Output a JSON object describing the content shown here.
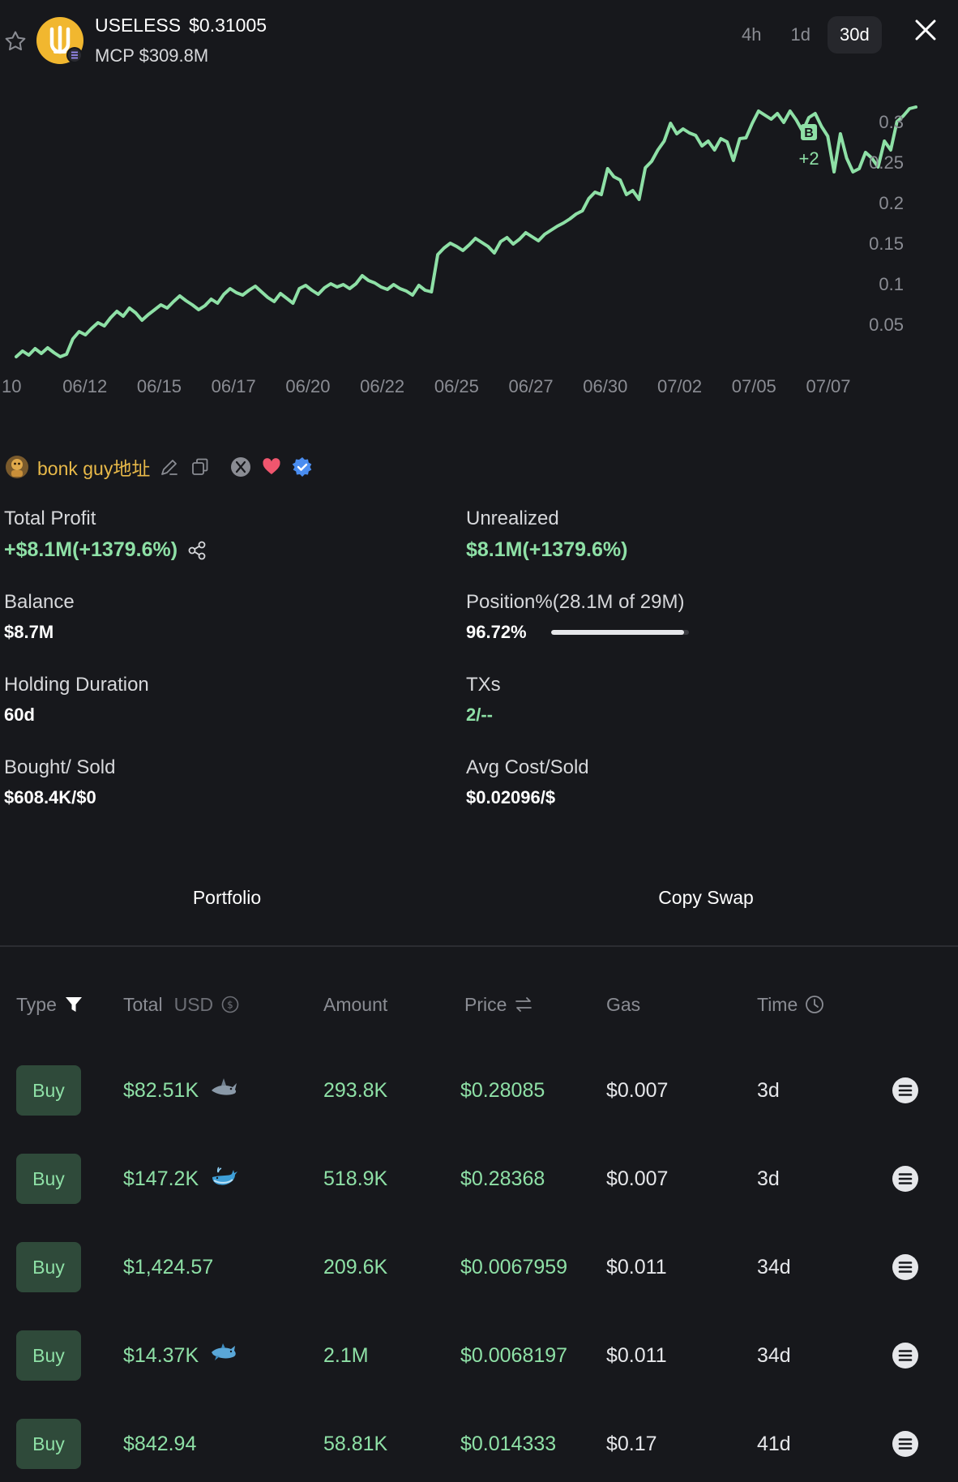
{
  "header": {
    "token_symbol": "USELESS",
    "price": "$0.31005",
    "mcp": "MCP $309.8M",
    "ranges": [
      "4h",
      "1d",
      "30d"
    ],
    "active_range": "30d"
  },
  "colors": {
    "background": "#17181c",
    "accent_green": "#8ee0a6",
    "wallet_name": "#e8b949",
    "logo": "#f1b72f"
  },
  "chart_data": {
    "type": "line",
    "series": [
      {
        "values": [
          0.01,
          0.017,
          0.012,
          0.02,
          0.014,
          0.021,
          0.015,
          0.01,
          0.013,
          0.032,
          0.041,
          0.037,
          0.045,
          0.052,
          0.048,
          0.058,
          0.066,
          0.06,
          0.07,
          0.064,
          0.055,
          0.062,
          0.068,
          0.074,
          0.07,
          0.078,
          0.085,
          0.079,
          0.074,
          0.068,
          0.073,
          0.081,
          0.076,
          0.087,
          0.094,
          0.089,
          0.086,
          0.092,
          0.097,
          0.09,
          0.083,
          0.078,
          0.088,
          0.082,
          0.076,
          0.094,
          0.098,
          0.092,
          0.087,
          0.095,
          0.1,
          0.096,
          0.099,
          0.094,
          0.1,
          0.11,
          0.104,
          0.101,
          0.096,
          0.093,
          0.099,
          0.094,
          0.091,
          0.086,
          0.098,
          0.092,
          0.09,
          0.136,
          0.144,
          0.15,
          0.146,
          0.141,
          0.148,
          0.156,
          0.151,
          0.146,
          0.138,
          0.152,
          0.157,
          0.149,
          0.155,
          0.163,
          0.158,
          0.153,
          0.161,
          0.166,
          0.171,
          0.175,
          0.18,
          0.186,
          0.19,
          0.205,
          0.213,
          0.21,
          0.242,
          0.232,
          0.228,
          0.21,
          0.215,
          0.204,
          0.243,
          0.251,
          0.265,
          0.276,
          0.298,
          0.285,
          0.291,
          0.286,
          0.283,
          0.27,
          0.276,
          0.265,
          0.279,
          0.275,
          0.252,
          0.279,
          0.28,
          0.298,
          0.313,
          0.308,
          0.303,
          0.31,
          0.299,
          0.313,
          0.302,
          0.288,
          0.305,
          0.31,
          0.294,
          0.282,
          0.238,
          0.285,
          0.255,
          0.238,
          0.242,
          0.262,
          0.255,
          0.244,
          0.276,
          0.265,
          0.3,
          0.307,
          0.316,
          0.318
        ],
        "color": "#8ee0a6"
      }
    ],
    "x_tick_labels": [
      "10",
      "06/12",
      "06/15",
      "06/17",
      "06/20",
      "06/22",
      "06/25",
      "06/27",
      "06/30",
      "07/02",
      "07/05",
      "07/07"
    ],
    "y_tick_labels": [
      "0.3",
      "0.25",
      "0.2",
      "0.15",
      "0.1",
      "0.05"
    ],
    "ylim": [
      0.0,
      0.35
    ],
    "grid": false,
    "annotations": [
      {
        "label": "B",
        "count": "+2",
        "index": 126
      }
    ]
  },
  "wallet": {
    "name": "bonk guy地址"
  },
  "stats": {
    "total_profit_label": "Total Profit",
    "total_profit_value": "+$8.1M(+1379.6%)",
    "unrealized_label": "Unrealized",
    "unrealized_value": "$8.1M(+1379.6%)",
    "balance_label": "Balance",
    "balance_value": "$8.7M",
    "position_label": "Position%(28.1M of 29M)",
    "position_value": "96.72%",
    "position_fraction": 0.9672,
    "holding_label": "Holding Duration",
    "holding_value": "60d",
    "txs_label": "TXs",
    "txs_value": "2/--",
    "bought_label": "Bought/ Sold",
    "bought_value": "$608.4K/$0",
    "avg_label": "Avg Cost/Sold",
    "avg_value": "$0.02096/$"
  },
  "tabs": {
    "portfolio": "Portfolio",
    "copy_swap": "Copy Swap"
  },
  "table": {
    "headers": {
      "type": "Type",
      "total": "Total",
      "total_unit": "USD",
      "amount": "Amount",
      "price": "Price",
      "gas": "Gas",
      "time": "Time"
    },
    "rows": [
      {
        "type": "Buy",
        "total": "$82.51K",
        "badge": "shark-icon",
        "amount": "293.8K",
        "price": "$0.28085",
        "gas": "$0.007",
        "time": "3d"
      },
      {
        "type": "Buy",
        "total": "$147.2K",
        "badge": "whale-icon",
        "amount": "518.9K",
        "price": "$0.28368",
        "gas": "$0.007",
        "time": "3d"
      },
      {
        "type": "Buy",
        "total": "$1,424.57",
        "badge": "",
        "amount": "209.6K",
        "price": "$0.0067959",
        "gas": "$0.011",
        "time": "34d"
      },
      {
        "type": "Buy",
        "total": "$14.37K",
        "badge": "dolphin-icon",
        "amount": "2.1M",
        "price": "$0.0068197",
        "gas": "$0.011",
        "time": "34d"
      },
      {
        "type": "Buy",
        "total": "$842.94",
        "badge": "",
        "amount": "58.81K",
        "price": "$0.014333",
        "gas": "$0.17",
        "time": "41d"
      }
    ]
  }
}
